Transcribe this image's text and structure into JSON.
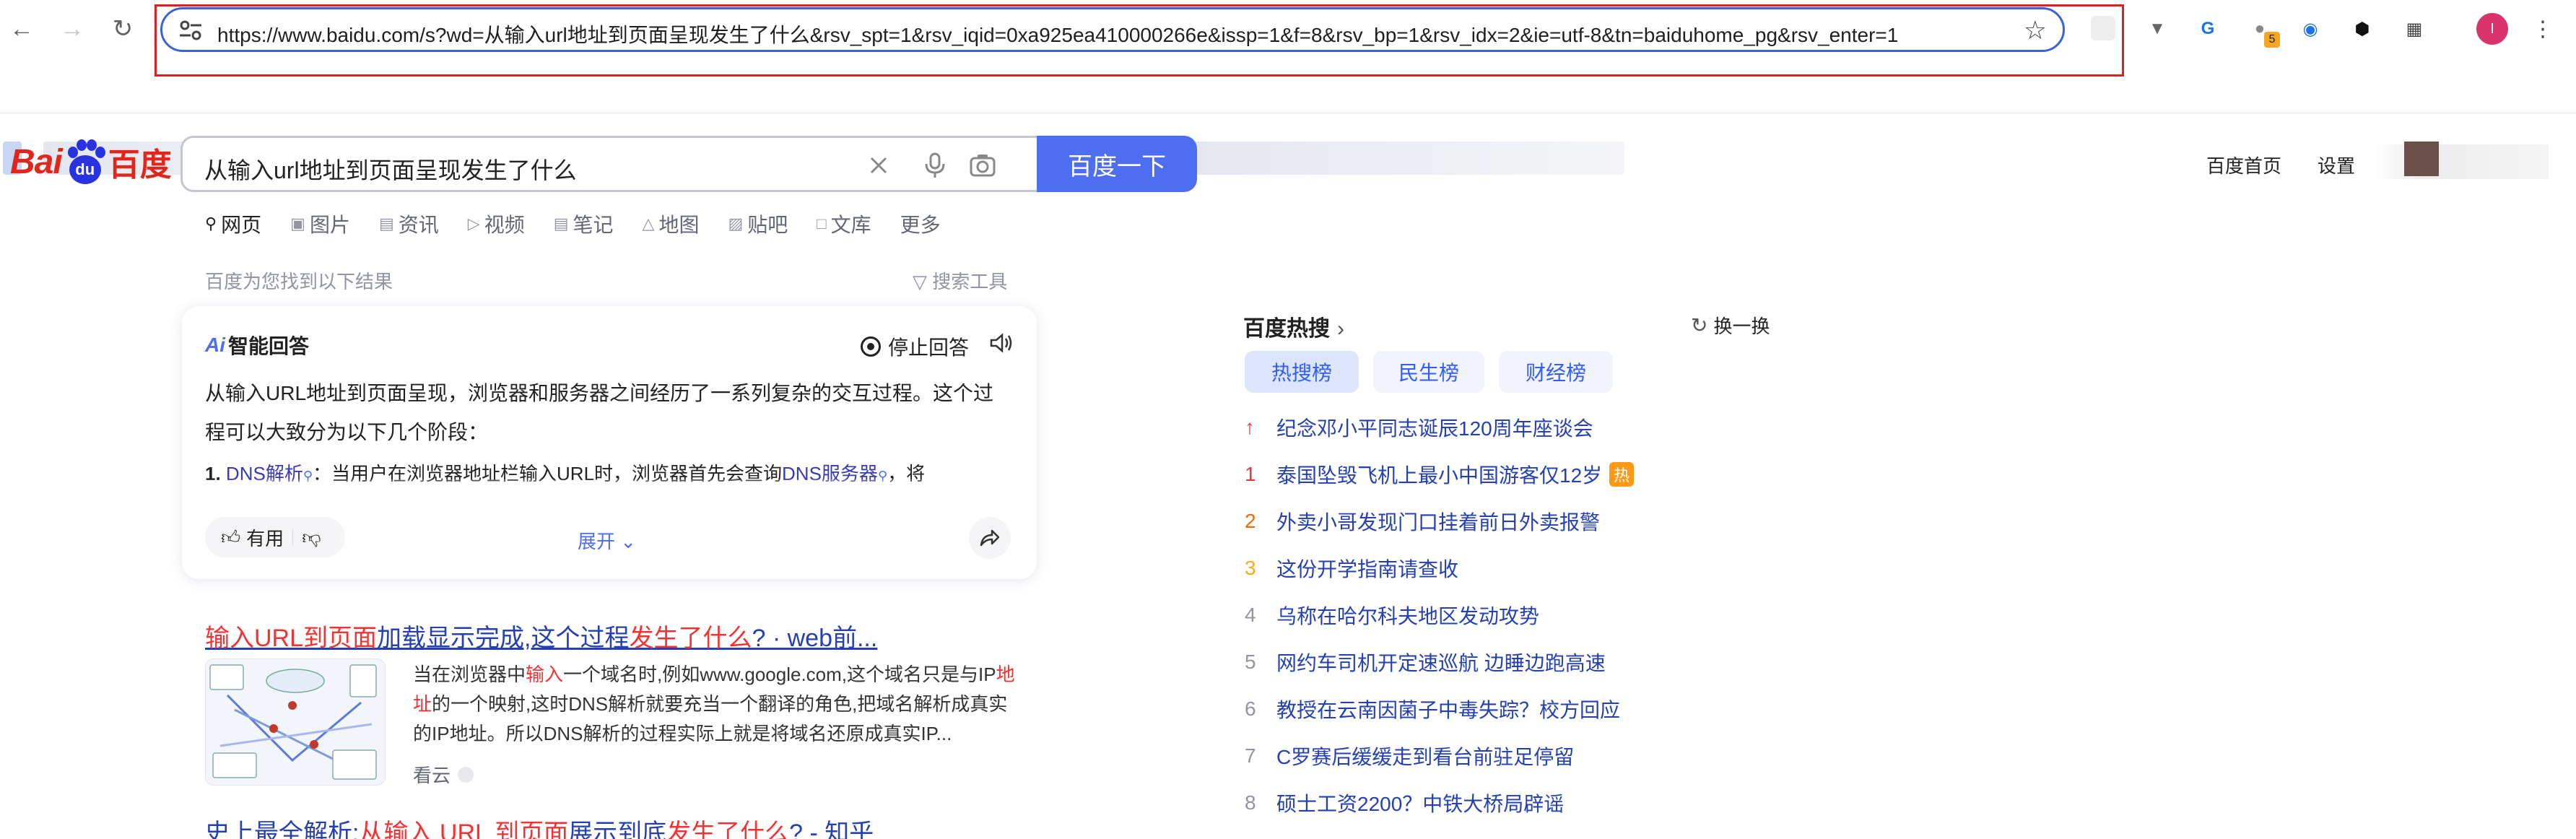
{
  "browser": {
    "url": "https://www.baidu.com/s?wd=从输入url地址到页面呈现发生了什么&rsv_spt=1&rsv_iqid=0xa925ea410000266e&issp=1&f=8&rsv_bp=1&rsv_idx=2&ie=utf-8&tn=baiduhome_pg&rsv_enter=1",
    "extension_badge": "5",
    "profile_initial": "I"
  },
  "header": {
    "logo_bai": "Bai",
    "logo_du": "du",
    "logo_cn": "百度",
    "query": "从输入url地址到页面呈现发生了什么",
    "search_button": "百度一下",
    "home_link": "百度首页",
    "settings_link": "设置"
  },
  "tabs": [
    "网页",
    "图片",
    "资讯",
    "视频",
    "笔记",
    "地图",
    "贴吧",
    "文库",
    "更多"
  ],
  "meta": {
    "result_count": "百度为您找到以下结果",
    "search_tools": "搜索工具"
  },
  "ai_answer": {
    "logo": "Ai",
    "title": "智能回答",
    "stop": "停止回答",
    "intro": "从输入URL地址到页面呈现，浏览器和服务器之间经历了一系列复杂的交互过程。这个过程可以大致分为以下几个阶段：",
    "point_num": "1.",
    "point_term": "DNS解析",
    "point_text": "：当用户在浏览器地址栏输入URL时，浏览器首先会查询",
    "point_term2": "DNS服务器",
    "point_tail": "，将",
    "useful": "有用",
    "expand": "展开"
  },
  "results": [
    {
      "title_parts": [
        "输入URL到页面",
        "加载显示完成,这个过程",
        "发生了什么",
        "? · web前..."
      ],
      "snippet_parts": [
        "当在浏览器中",
        "输入",
        "一个域名时,例如www.google.com,这个域名只是与IP",
        "地址",
        "的一个映射,这时DNS解析就要充当一个翻译的角色,把域名解析成真实的IP地址。所以DNS解析的过程实际上就是将域名还原成真实IP..."
      ],
      "source": "看云"
    },
    {
      "title_parts": [
        "史上最全解析:",
        "从输入 URL 到页面",
        "展示到底",
        "发生了什么",
        "? - 知乎"
      ]
    }
  ],
  "hot": {
    "title": "百度热搜",
    "refresh": "换一换",
    "tabs": [
      "热搜榜",
      "民生榜",
      "财经榜"
    ],
    "items": [
      {
        "rank": "↑",
        "text": "纪念邓小平同志诞辰120周年座谈会",
        "badge": ""
      },
      {
        "rank": "1",
        "text": "泰国坠毁飞机上最小中国游客仅12岁",
        "badge": "热"
      },
      {
        "rank": "2",
        "text": "外卖小哥发现门口挂着前日外卖报警",
        "badge": ""
      },
      {
        "rank": "3",
        "text": "这份开学指南请查收",
        "badge": ""
      },
      {
        "rank": "4",
        "text": "乌称在哈尔科夫地区发动攻势",
        "badge": ""
      },
      {
        "rank": "5",
        "text": "网约车司机开定速巡航 边睡边跑高速",
        "badge": ""
      },
      {
        "rank": "6",
        "text": "教授在云南因菌子中毒失踪？校方回应",
        "badge": ""
      },
      {
        "rank": "7",
        "text": "C罗赛后缓缓走到看台前驻足停留",
        "badge": ""
      },
      {
        "rank": "8",
        "text": "硕士工资2200？中铁大桥局辟谣",
        "badge": ""
      }
    ]
  }
}
